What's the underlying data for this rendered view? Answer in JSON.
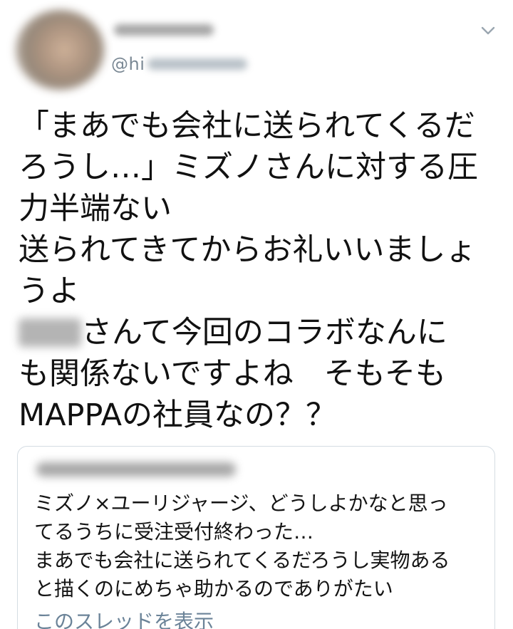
{
  "tweet": {
    "handle_prefix": "@hi",
    "text_lines": [
      "「まあでも会社に送られてくるだ",
      "ろうし…」ミズノさんに対する圧",
      "力半端ない",
      "送られてきてからお礼いいましょ",
      "うよ"
    ],
    "line6_suffix": "さんて今回のコラボなんに",
    "text_lines_tail": [
      "も関係ないですよね　そもそも",
      "MAPPAの社員なの？？"
    ]
  },
  "quote": {
    "text_lines": [
      "ミズノ×ユーリジャージ、どうしよかなと思っ",
      "てるうちに受注受付終わった…",
      "まあでも会社に送られてくるだろうし実物ある",
      "と描くのにめちゃ助かるのでありがたい"
    ],
    "show_thread_label": "このスレッドを表示"
  },
  "icons": {
    "menu": "chevron-down-icon"
  },
  "colors": {
    "link": "#6b8398",
    "handle": "#7a8894",
    "border": "#d5dde3"
  }
}
